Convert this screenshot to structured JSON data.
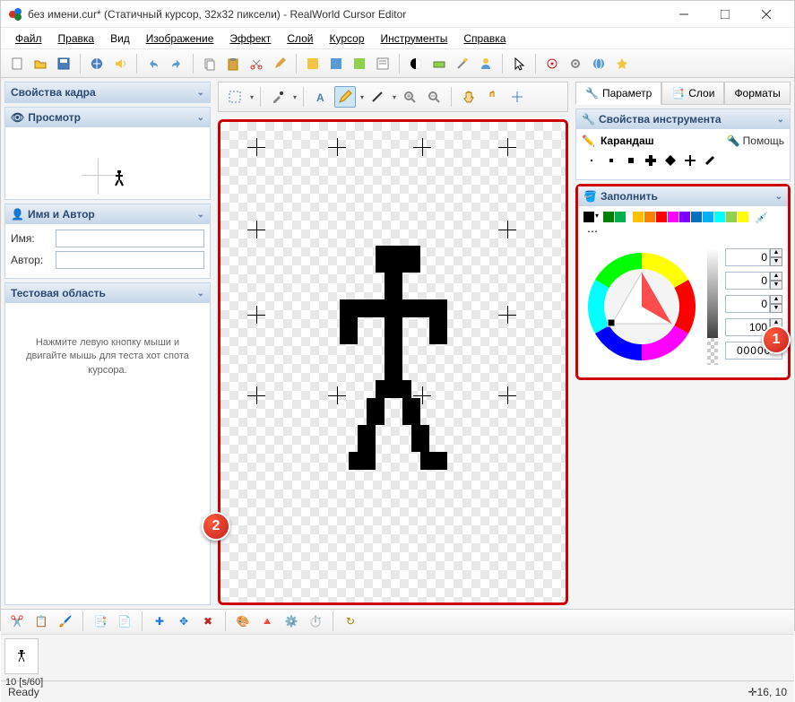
{
  "window": {
    "title": "без имени.cur* (Статичный курсор, 32x32 пиксели) - RealWorld Cursor Editor"
  },
  "menu": {
    "file": "Файл",
    "edit": "Правка",
    "view": "Вид",
    "image": "Изображение",
    "effect": "Эффект",
    "layer": "Слой",
    "cursor": "Курсор",
    "tools": "Инструменты",
    "help": "Справка"
  },
  "left": {
    "frameProps": "Свойства кадра",
    "preview": "Просмотр",
    "nameAuthor": "Имя и Автор",
    "nameLabel": "Имя:",
    "authorLabel": "Автор:",
    "nameValue": "",
    "authorValue": "",
    "testArea": "Тестовая область",
    "testHint": "Нажмите левую кнопку мыши и двигайте мышь для теста хот спота курсора."
  },
  "right": {
    "tabs": {
      "params": "Параметр",
      "layers": "Слои",
      "formats": "Форматы"
    },
    "toolProps": "Свойства инструмента",
    "toolName": "Карандаш",
    "help": "Помощь",
    "fill": "Заполнить",
    "swatches": [
      "#000000",
      "#404040",
      "#008000",
      "#00b050",
      "#808080",
      "#c0c0c0",
      "#ffc000",
      "#ff8000",
      "#ff0000",
      "#ff00ff",
      "#8000ff",
      "#0070c0",
      "#00b0f0",
      "#00ffff",
      "#92d050",
      "#ffff00",
      "#ffffff"
    ],
    "h": "0",
    "s": "0",
    "v": "0",
    "a": "100",
    "hex": "000000"
  },
  "frames": {
    "label": "10 [s/60]"
  },
  "status": {
    "ready": "Ready",
    "coords": "16, 10"
  }
}
